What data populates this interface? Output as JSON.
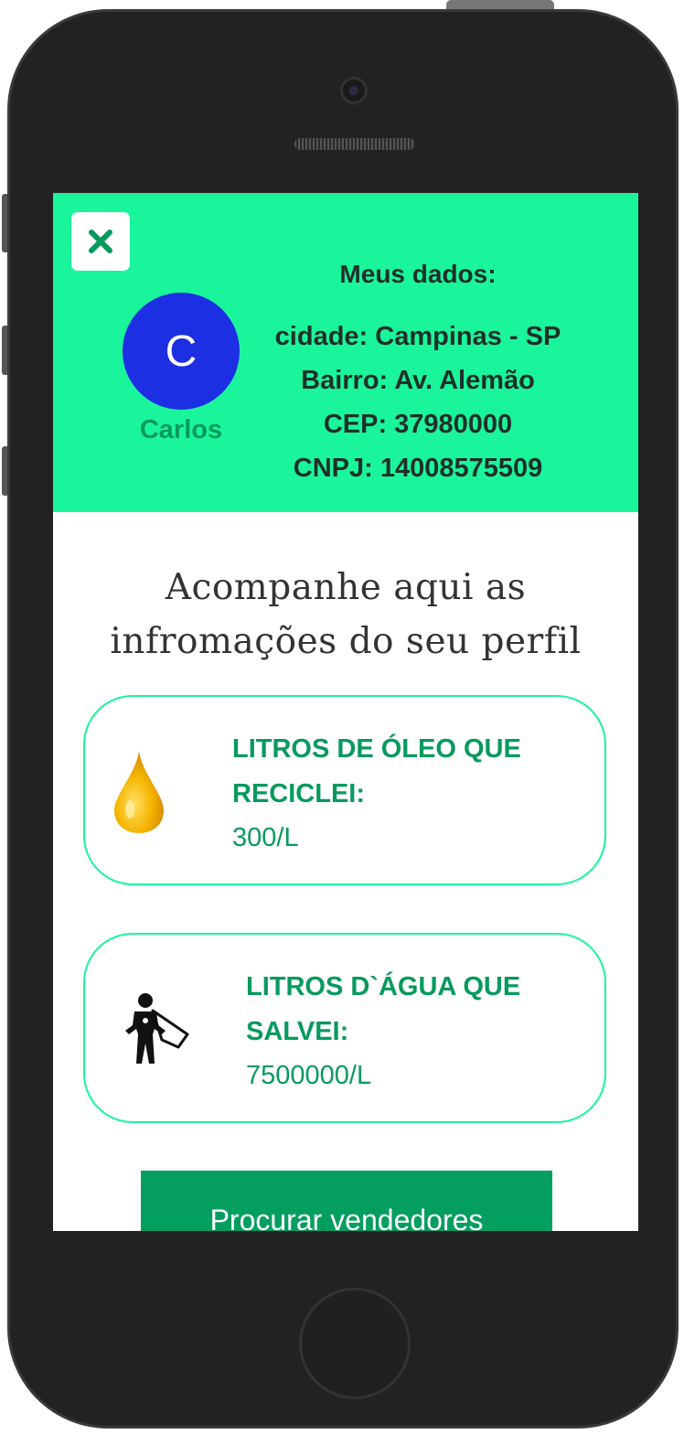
{
  "profile": {
    "avatar_letter": "C",
    "name": "Carlos",
    "colors": {
      "header_bg": "#1af59b",
      "avatar_bg": "#1c2fe3",
      "accent": "#079a5e"
    }
  },
  "info": {
    "title": "Meus dados:",
    "city": "cidade: Campinas - SP",
    "neighborhood": "Bairro: Av. Alemão",
    "cep": "CEP: 37980000",
    "cnpj": "CNPJ: 14008575509"
  },
  "close_icon": "close-icon",
  "main": {
    "subtitle_line1": "Acompanhe aqui as",
    "subtitle_line2": "infromações do seu perfil"
  },
  "cards": [
    {
      "icon": "oil-drop-icon",
      "title_line1": "LITROS DE ÓLEO QUE",
      "title_line2": "RECICLEI:",
      "value": "300/L"
    },
    {
      "icon": "superhero-icon",
      "title_line1": "LITROS D`ÁGUA QUE",
      "title_line2": "SALVEI:",
      "value": "7500000/L"
    }
  ],
  "actions": {
    "search_label": "Procurar vendedores"
  }
}
